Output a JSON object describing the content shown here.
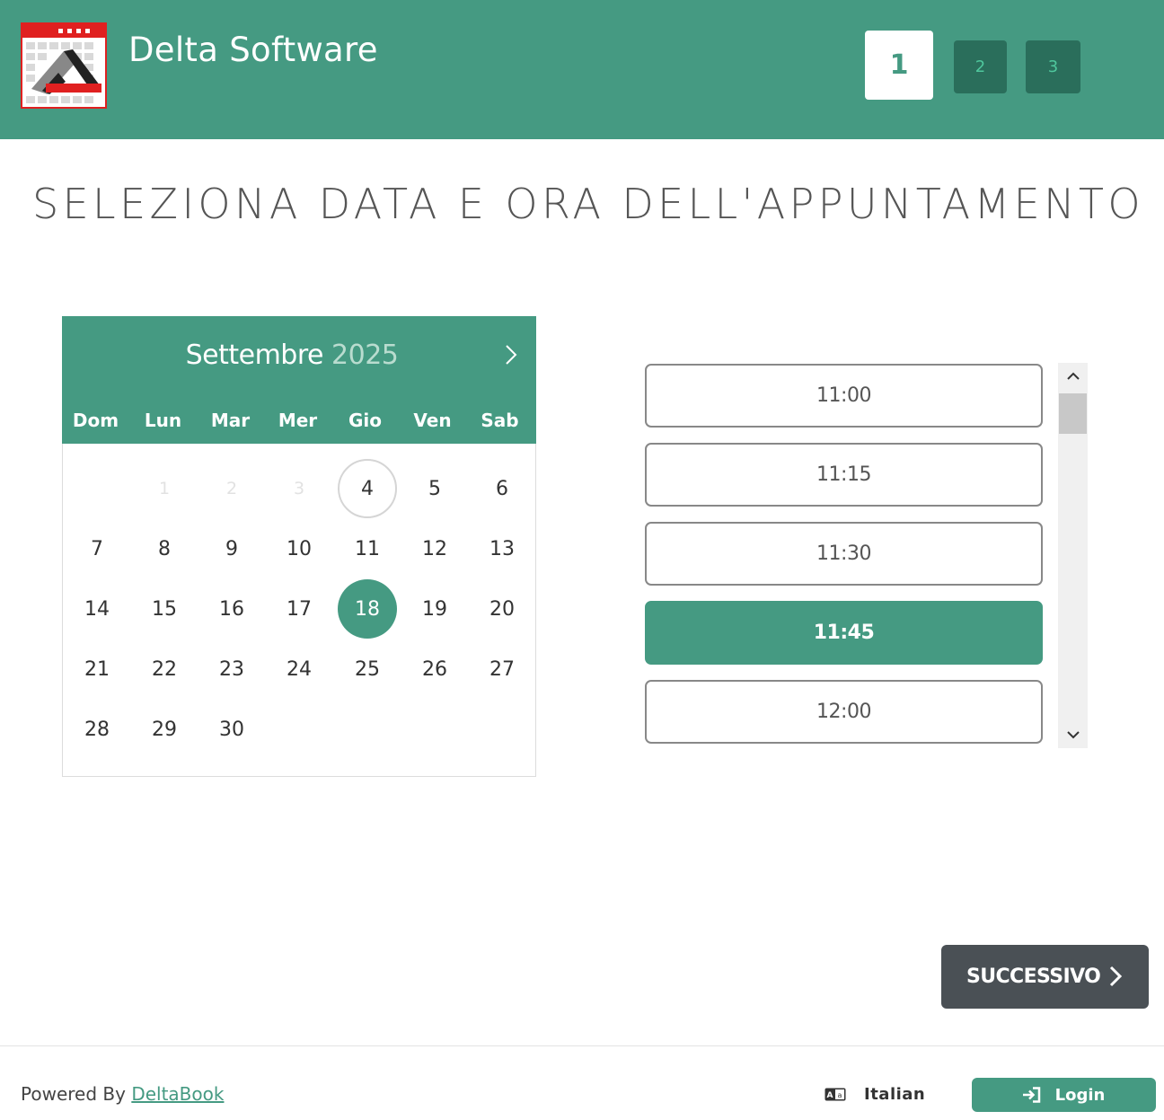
{
  "header": {
    "brand": "Delta Software",
    "steps": [
      {
        "label": "1",
        "active": true
      },
      {
        "label": "2",
        "active": false
      },
      {
        "label": "3",
        "active": false
      }
    ]
  },
  "page_title": "SELEZIONA DATA E ORA DELL'APPUNTAMENTO",
  "calendar": {
    "month": "Settembre",
    "year": "2025",
    "next_icon": "chevron-right-icon",
    "weekdays": [
      "Dom",
      "Lun",
      "Mar",
      "Mer",
      "Gio",
      "Ven",
      "Sab"
    ],
    "disabled_days": [
      "1",
      "2",
      "3"
    ],
    "today": "4",
    "selected": "18",
    "weeks": [
      [
        "",
        "1",
        "2",
        "3",
        "4",
        "5",
        "6"
      ],
      [
        "7",
        "8",
        "9",
        "10",
        "11",
        "12",
        "13"
      ],
      [
        "14",
        "15",
        "16",
        "17",
        "18",
        "19",
        "20"
      ],
      [
        "21",
        "22",
        "23",
        "24",
        "25",
        "26",
        "27"
      ],
      [
        "28",
        "29",
        "30",
        "",
        "",
        "",
        ""
      ]
    ]
  },
  "time_slots": {
    "items": [
      "11:00",
      "11:15",
      "11:30",
      "11:45",
      "12:00"
    ],
    "selected": "11:45"
  },
  "next_button": {
    "label": "SUCCESSIVO",
    "icon": "chevron-right-icon"
  },
  "footer": {
    "powered_prefix": "Powered By",
    "powered_link": "DeltaBook",
    "language": "Italian",
    "language_icon": "language-icon",
    "login_label": "Login",
    "login_icon": "sign-in-icon"
  },
  "colors": {
    "primary": "#459a82",
    "step_inactive": "#2a6e5b",
    "next_button": "#4a5055",
    "logo_red": "#e02020"
  }
}
